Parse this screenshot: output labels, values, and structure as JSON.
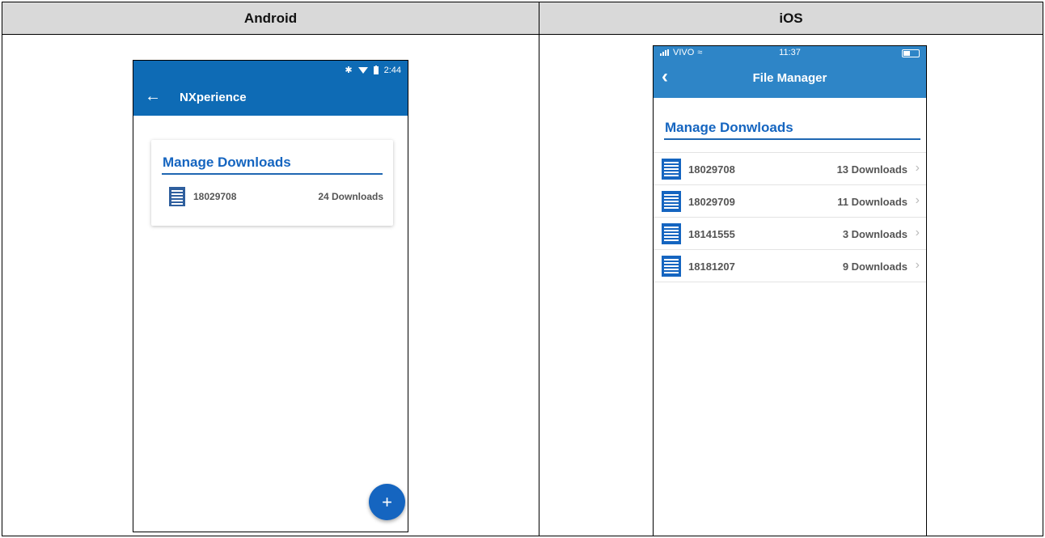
{
  "columns": {
    "android": "Android",
    "ios": "iOS"
  },
  "android": {
    "status": {
      "time": "2:44",
      "icons": [
        "bluetooth-icon",
        "wifi-icon",
        "battery-icon"
      ]
    },
    "appbar": {
      "back_icon": "←",
      "title": "NXperience"
    },
    "card": {
      "title": "Manage Downloads",
      "items": [
        {
          "id": "18029708",
          "count": "24 Downloads"
        }
      ]
    },
    "fab": {
      "label": "+"
    },
    "colors": {
      "primary": "#0e6bb5",
      "accent": "#1565c0"
    }
  },
  "ios": {
    "status": {
      "carrier": "VIVO",
      "time": "11:37"
    },
    "nav": {
      "back_icon": "‹",
      "title": "File Manager"
    },
    "section_title": "Manage Donwloads",
    "items": [
      {
        "id": "18029708",
        "count": "13 Downloads"
      },
      {
        "id": "18029709",
        "count": "11 Downloads"
      },
      {
        "id": "18141555",
        "count": "3 Downloads"
      },
      {
        "id": "18181207",
        "count": "9 Downloads"
      }
    ],
    "colors": {
      "primary": "#2e85c7",
      "accent": "#1565c0"
    }
  }
}
